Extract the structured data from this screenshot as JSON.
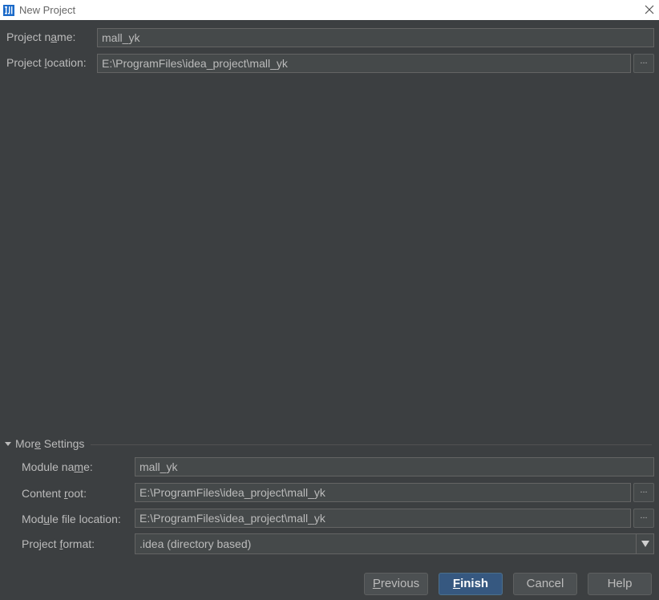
{
  "window": {
    "title": "New Project"
  },
  "project": {
    "name_label": "Project name:",
    "name_value": "mall_yk",
    "location_label": "Project location:",
    "location_value": "E:\\ProgramFiles\\idea_project\\mall_yk",
    "browse_label": "..."
  },
  "more_settings": {
    "label": "More Settings",
    "module_name_label": "Module name:",
    "module_name_value": "mall_yk",
    "content_root_label": "Content root:",
    "content_root_value": "E:\\ProgramFiles\\idea_project\\mall_yk",
    "module_file_label": "Module file location:",
    "module_file_value": "E:\\ProgramFiles\\idea_project\\mall_yk",
    "project_format_label": "Project format:",
    "project_format_value": ".idea (directory based)",
    "browse_label": "..."
  },
  "buttons": {
    "previous": "Previous",
    "finish": "Finish",
    "cancel": "Cancel",
    "help": "Help"
  },
  "colors": {
    "background": "#3c3f41",
    "field": "#45494a",
    "primary_button": "#365880",
    "text": "#bbbbbb"
  }
}
